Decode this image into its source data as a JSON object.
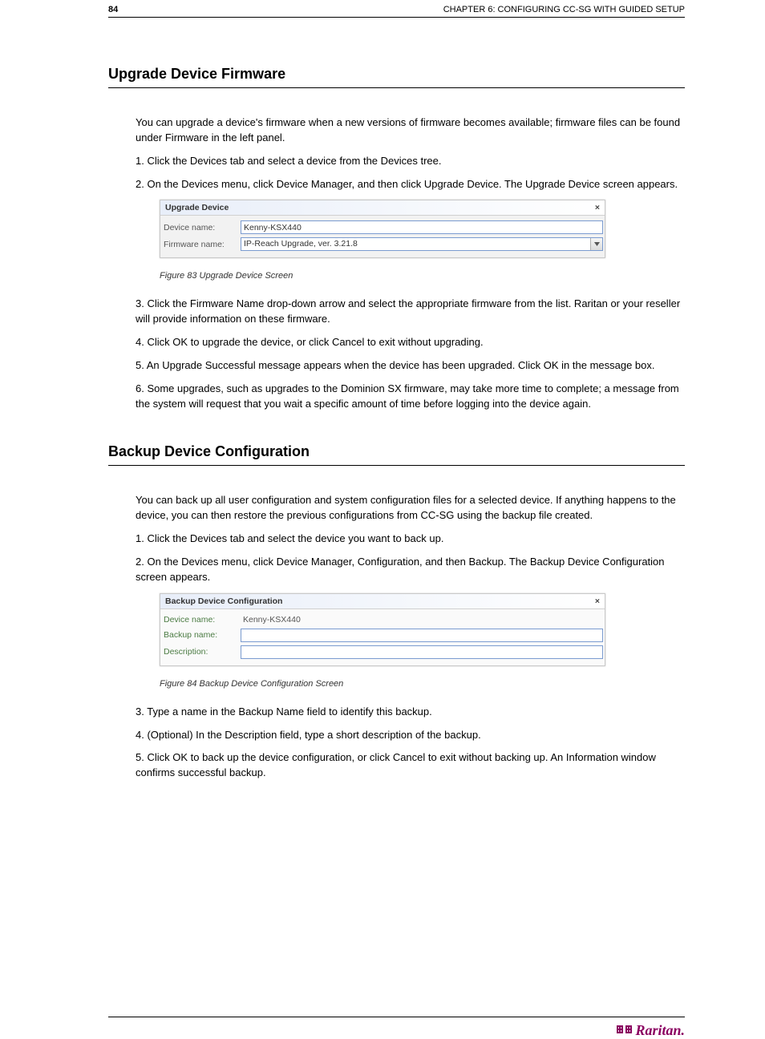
{
  "header": {
    "page_label": "84",
    "chapter": "CHAPTER 6: CONFIGURING CC-SG WITH GUIDED SETUP"
  },
  "section1": {
    "title": "Upgrade Device Firmware",
    "p1": "You can upgrade a device's firmware when a new versions of firmware becomes available; firmware files can be found under Firmware in the left panel.",
    "p2": "1.   Click the Devices tab and select a device from the Devices tree.",
    "p3": "2.   On the Devices menu, click Device Manager, and then click Upgrade Device. The Upgrade Device screen appears.",
    "figure": {
      "title": "Upgrade Device",
      "device_label": "Device name:",
      "device_value": "Kenny-KSX440",
      "firmware_label": "Firmware name:",
      "firmware_value": "IP-Reach Upgrade, ver. 3.21.8"
    },
    "caption": "Figure 83 Upgrade Device Screen",
    "p4": "3.   Click the Firmware Name drop-down arrow and select the appropriate firmware from the list. Raritan or your reseller will provide information on these firmware.",
    "p5": "4.   Click OK to upgrade the device, or click Cancel to exit without upgrading.",
    "p6": "5.   An Upgrade Successful message appears when the device has been upgraded. Click OK in the message box.",
    "p7": "6.   Some upgrades, such as upgrades to the Dominion SX firmware, may take more time to complete; a message from the system will request that you wait a specific amount of time before logging into the device again."
  },
  "section2": {
    "title": "Backup Device Configuration",
    "p1": "You can back up all user configuration and system configuration files for a selected device. If anything happens to the device, you can then restore the previous configurations from CC-SG using the backup file created.",
    "p2": "1.   Click the Devices tab and select the device you want to back up.",
    "p3": "2.   On the Devices menu, click Device Manager, Configuration, and then Backup. The Backup Device Configuration screen appears.",
    "figure": {
      "title": "Backup Device Configuration",
      "device_label": "Device name:",
      "device_value": "Kenny-KSX440",
      "backup_label": "Backup name:",
      "backup_value": "",
      "desc_label": "Description:",
      "desc_value": ""
    },
    "caption": "Figure 84 Backup Device Configuration Screen",
    "p4": "3.   Type a name in the Backup Name field to identify this backup.",
    "p5": "4.   (Optional) In the Description field, type a short description of the backup.",
    "p6": "5.   Click OK to back up the device configuration, or click Cancel to exit without backing up. An Information window confirms successful backup."
  },
  "footer": {
    "page_num": "",
    "brand_text": "Raritan."
  }
}
